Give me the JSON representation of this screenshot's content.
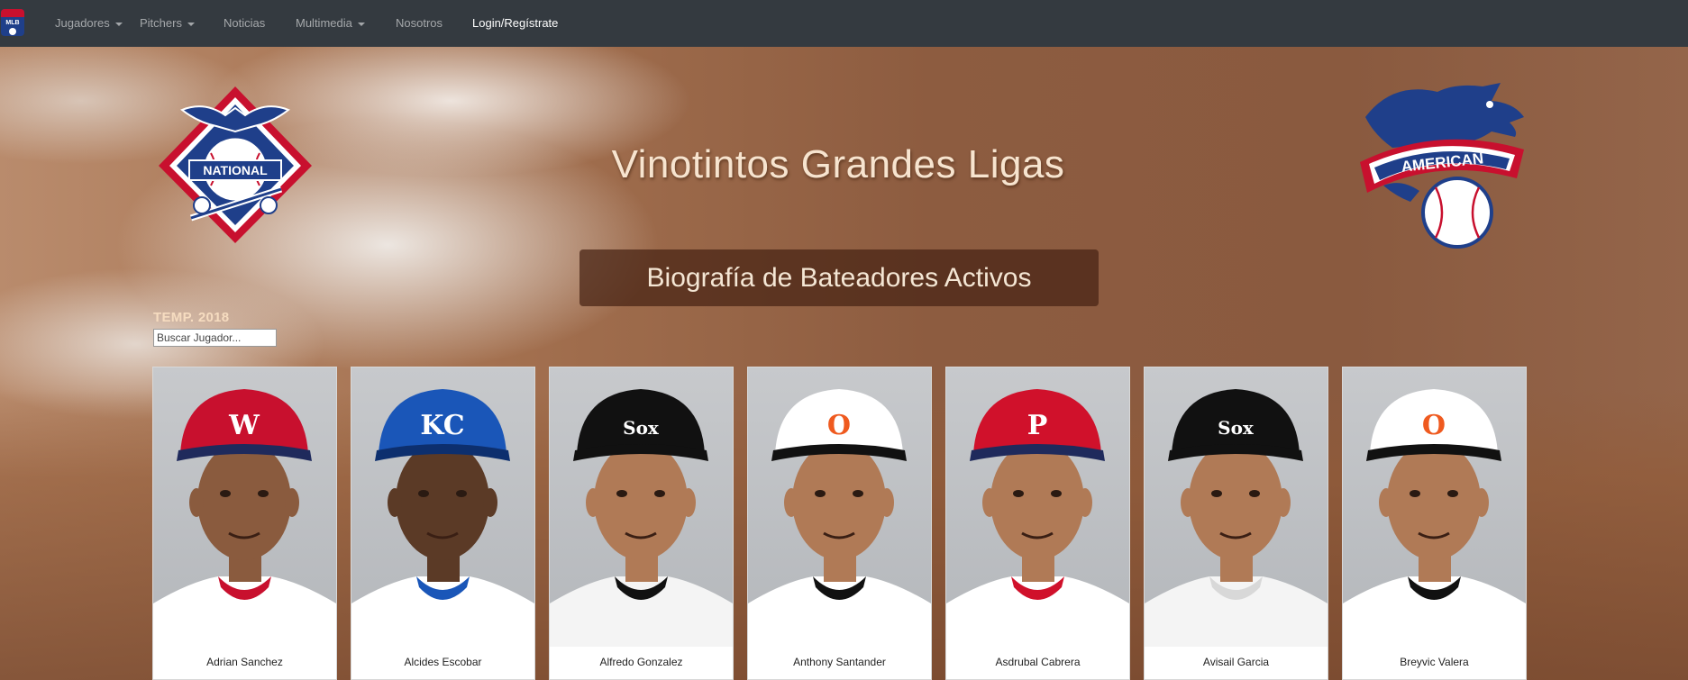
{
  "nav": {
    "items": [
      {
        "label": "Jugadores",
        "dropdown": true
      },
      {
        "label": "Pitchers",
        "dropdown": true
      },
      {
        "label": "Noticias",
        "dropdown": false
      },
      {
        "label": "Multimedia",
        "dropdown": true
      },
      {
        "label": "Nosotros",
        "dropdown": false
      },
      {
        "label": "Login/Regístrate",
        "dropdown": false
      }
    ],
    "brand_text": "MLB"
  },
  "hero": {
    "title": "Vinotintos Grandes Ligas",
    "subtitle": "Biografía de Bateadores Activos",
    "nl_logo_text": "NATIONAL",
    "al_logo_text": "AMERICAN"
  },
  "filter": {
    "season": "TEMP. 2018",
    "search_placeholder": "Buscar Jugador..."
  },
  "players": [
    {
      "name": "Adrian Sanchez",
      "team_mark": "W",
      "cap": "#c8102e",
      "brim": "#1f2a5c",
      "logo": "#ffffff",
      "jersey": "#ffffff",
      "trim": "#c8102e"
    },
    {
      "name": "Alcides Escobar",
      "team_mark": "KC",
      "cap": "#1a56b8",
      "brim": "#0d2f6e",
      "logo": "#ffffff",
      "jersey": "#ffffff",
      "trim": "#1a56b8"
    },
    {
      "name": "Alfredo Gonzalez",
      "team_mark": "Sox",
      "cap": "#111111",
      "brim": "#111111",
      "logo": "#ffffff",
      "jersey": "#f4f4f4",
      "trim": "#111111"
    },
    {
      "name": "Anthony Santander",
      "team_mark": "O",
      "cap": "#ffffff",
      "brim": "#111111",
      "logo": "#ef5a1f",
      "jersey": "#ffffff",
      "trim": "#111111"
    },
    {
      "name": "Asdrubal Cabrera",
      "team_mark": "P",
      "cap": "#d0112b",
      "brim": "#1f2a5c",
      "logo": "#ffffff",
      "jersey": "#ffffff",
      "trim": "#d0112b"
    },
    {
      "name": "Avisail Garcia",
      "team_mark": "Sox",
      "cap": "#111111",
      "brim": "#111111",
      "logo": "#ffffff",
      "jersey": "#f4f4f4",
      "trim": "#d8d8d8"
    },
    {
      "name": "Breyvic Valera",
      "team_mark": "O",
      "cap": "#ffffff",
      "brim": "#111111",
      "logo": "#ef5a1f",
      "jersey": "#ffffff",
      "trim": "#111111"
    }
  ]
}
